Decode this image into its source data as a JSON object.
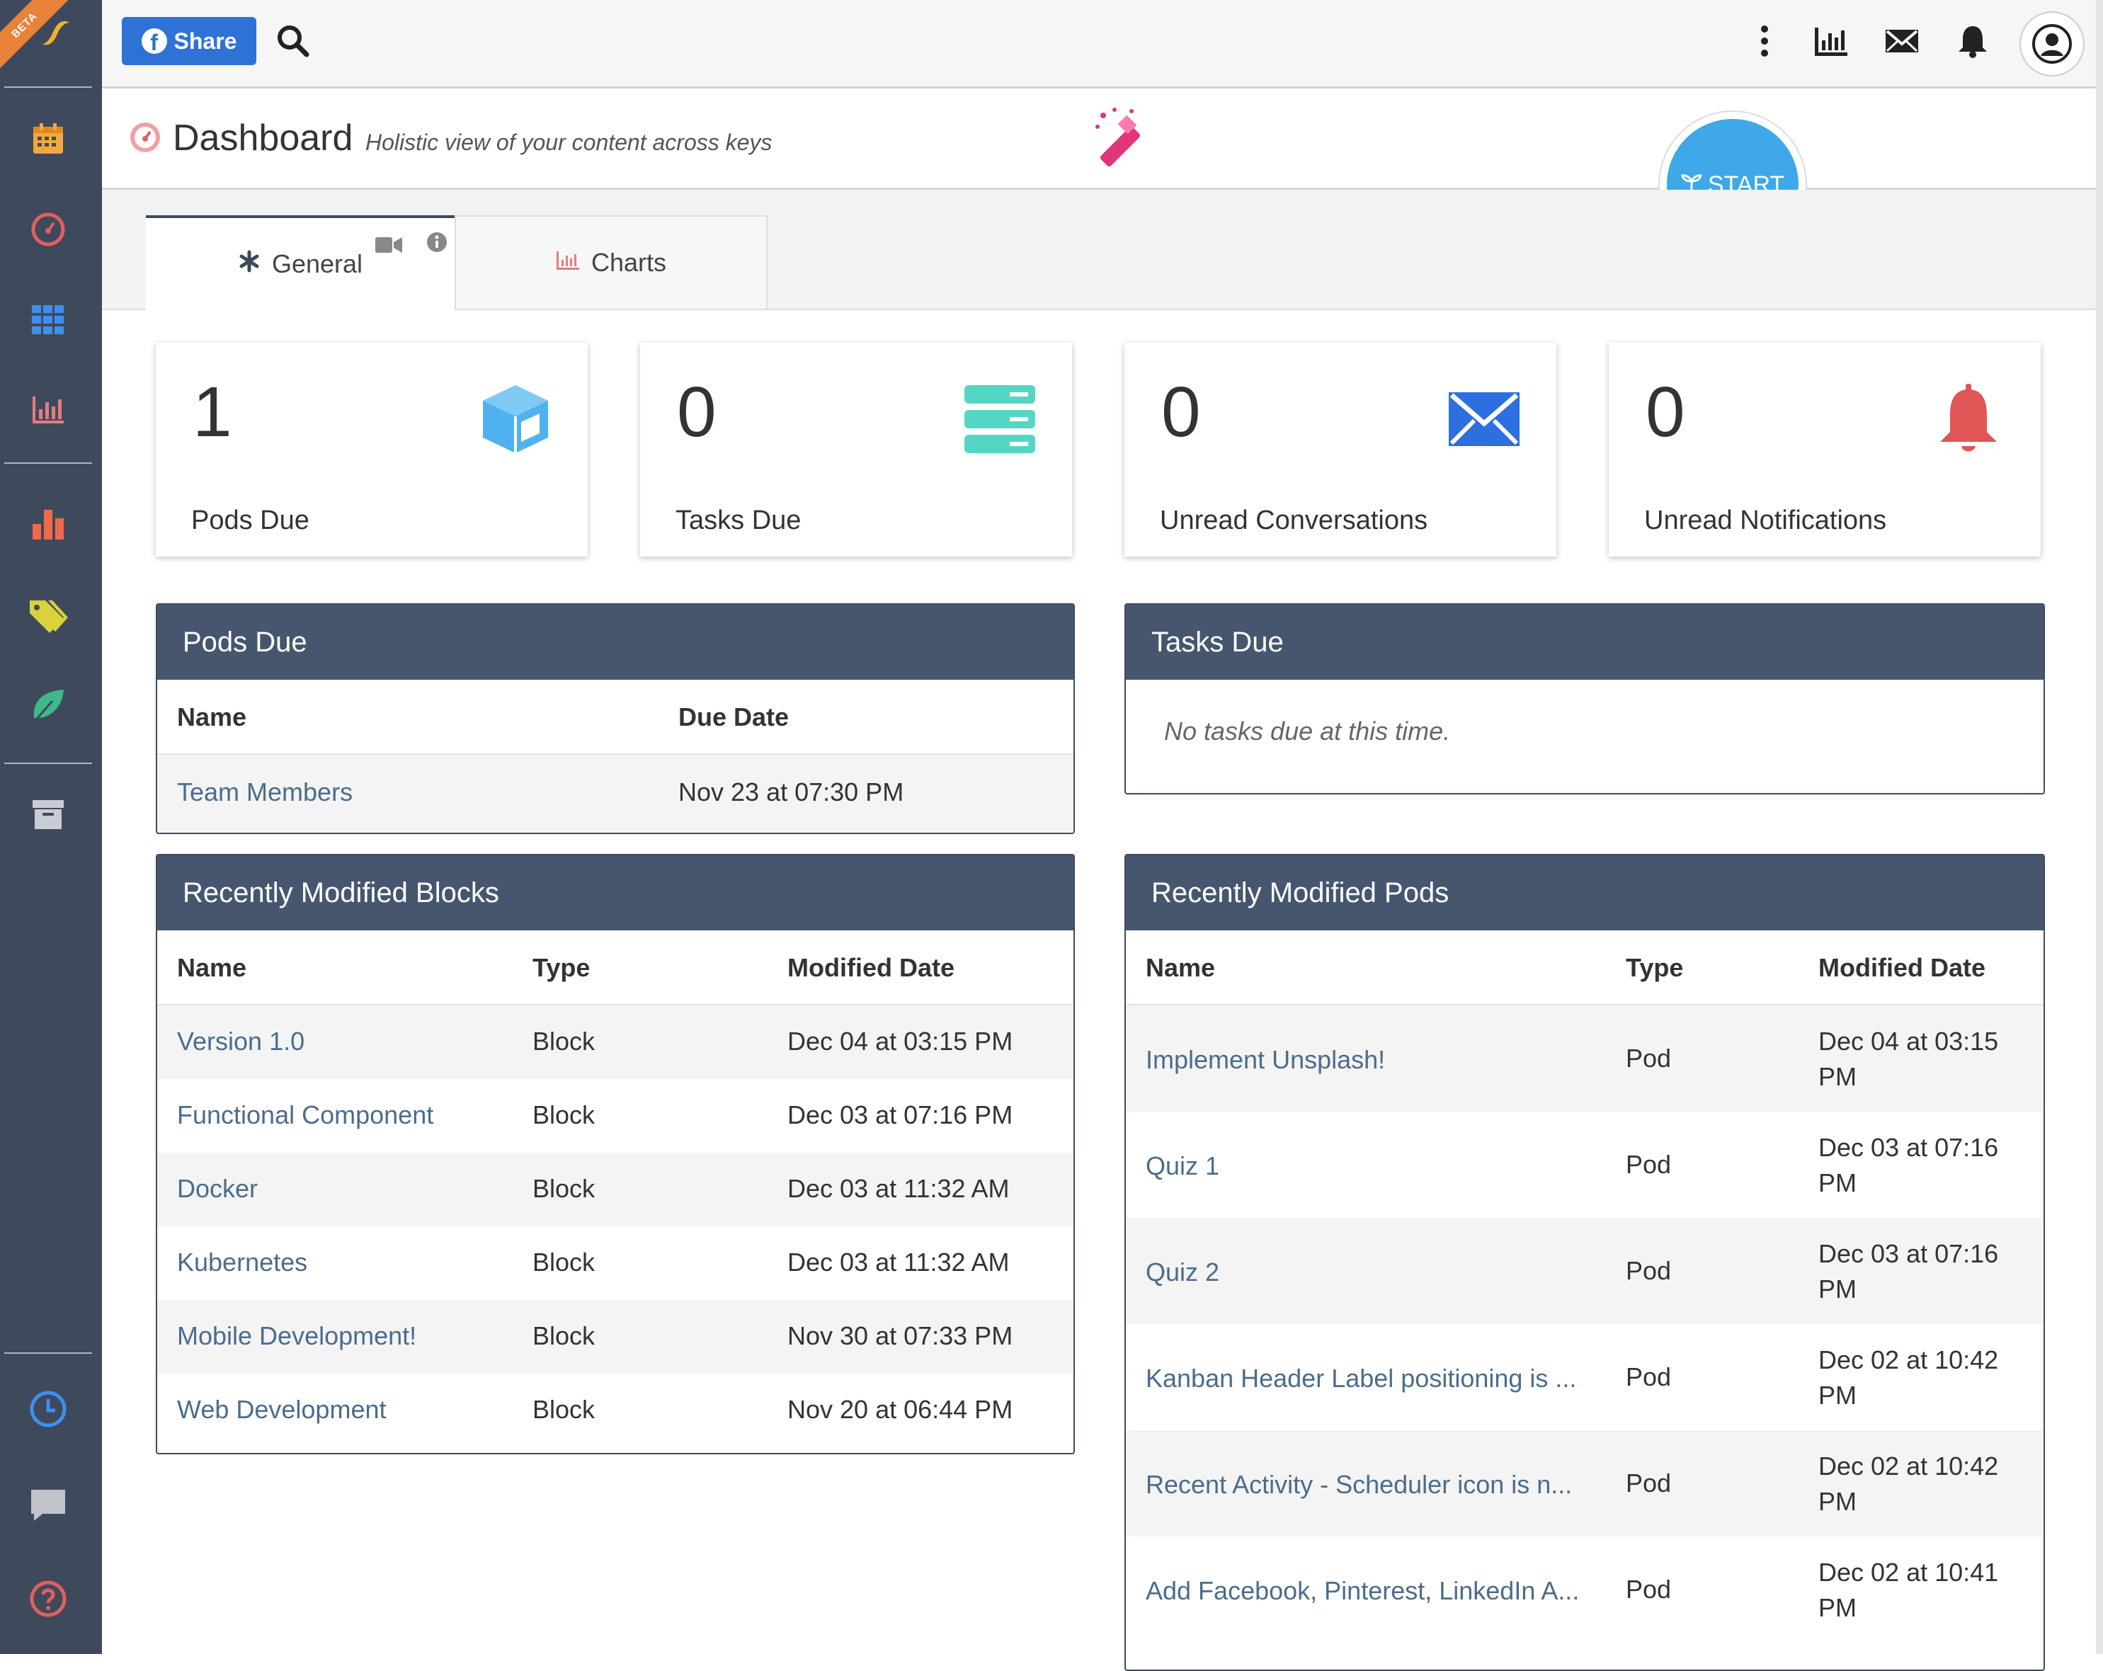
{
  "sidebar": {
    "beta_label": "BETA"
  },
  "topbar": {
    "share_label": "Share",
    "fb_letter": "f"
  },
  "header": {
    "title": "Dashboard",
    "subtitle": "Holistic view of your content across keys"
  },
  "start_button": {
    "label": "START"
  },
  "tabs": [
    {
      "label": "General"
    },
    {
      "label": "Charts"
    }
  ],
  "stats": [
    {
      "value": "1",
      "label": "Pods Due"
    },
    {
      "value": "0",
      "label": "Tasks Due"
    },
    {
      "value": "0",
      "label": "Unread Conversations"
    },
    {
      "value": "0",
      "label": "Unread Notifications"
    }
  ],
  "pods_due": {
    "title": "Pods Due",
    "headers": [
      "Name",
      "Due Date"
    ],
    "rows": [
      {
        "name": "Team Members",
        "due": "Nov 23 at 07:30 PM"
      }
    ]
  },
  "tasks_due": {
    "title": "Tasks Due",
    "empty_text": "No tasks due at this time."
  },
  "blocks": {
    "title": "Recently Modified Blocks",
    "headers": [
      "Name",
      "Type",
      "Modified Date"
    ],
    "rows": [
      {
        "name": "Version 1.0",
        "type": "Block",
        "date": "Dec 04 at 03:15 PM"
      },
      {
        "name": "Functional Component",
        "type": "Block",
        "date": "Dec 03 at 07:16 PM"
      },
      {
        "name": "Docker",
        "type": "Block",
        "date": "Dec 03 at 11:32 AM"
      },
      {
        "name": "Kubernetes",
        "type": "Block",
        "date": "Dec 03 at 11:32 AM"
      },
      {
        "name": "Mobile Development!",
        "type": "Block",
        "date": "Nov 30 at 07:33 PM"
      },
      {
        "name": "Web Development",
        "type": "Block",
        "date": "Nov 20 at 06:44 PM"
      }
    ]
  },
  "pods": {
    "title": "Recently Modified Pods",
    "headers": [
      "Name",
      "Type",
      "Modified Date"
    ],
    "rows": [
      {
        "name": "Implement Unsplash!",
        "type": "Pod",
        "date1": "Dec 04 at 03:15",
        "date2": "PM"
      },
      {
        "name": "Quiz 1",
        "type": "Pod",
        "date1": "Dec 03 at 07:16",
        "date2": "PM"
      },
      {
        "name": "Quiz 2",
        "type": "Pod",
        "date1": "Dec 03 at 07:16",
        "date2": "PM"
      },
      {
        "name": "Kanban Header Label positioning is ...",
        "type": "Pod",
        "date1": "Dec 02 at 10:42",
        "date2": "PM"
      },
      {
        "name": "Recent Activity - Scheduler icon is n...",
        "type": "Pod",
        "date1": "Dec 02 at 10:42",
        "date2": "PM"
      },
      {
        "name": "Add Facebook, Pinterest, LinkedIn A...",
        "type": "Pod",
        "date1": "Dec 02 at 10:41",
        "date2": "PM"
      }
    ]
  }
}
